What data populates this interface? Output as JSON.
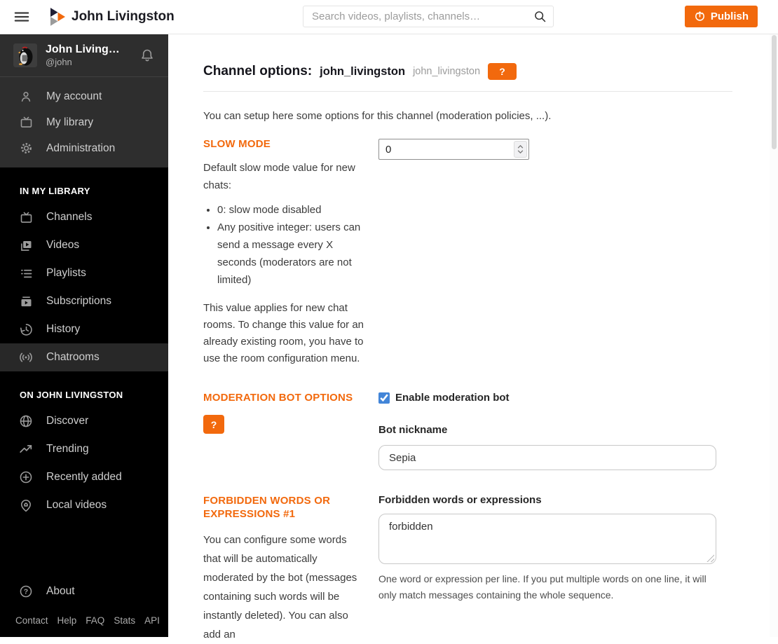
{
  "header": {
    "instance_name": "John Livingston",
    "search_placeholder": "Search videos, playlists, channels…",
    "publish_label": "Publish"
  },
  "sidebar": {
    "user": {
      "name": "John Livingston",
      "handle": "@john"
    },
    "account_menu": [
      {
        "label": "My account",
        "icon": "user-icon"
      },
      {
        "label": "My library",
        "icon": "tv-icon"
      },
      {
        "label": "Administration",
        "icon": "gear-icon"
      }
    ],
    "sections": [
      {
        "title": "IN MY LIBRARY",
        "items": [
          {
            "label": "Channels",
            "icon": "tv-icon"
          },
          {
            "label": "Videos",
            "icon": "videos-icon"
          },
          {
            "label": "Playlists",
            "icon": "playlist-icon"
          },
          {
            "label": "Subscriptions",
            "icon": "subscriptions-icon"
          },
          {
            "label": "History",
            "icon": "history-icon"
          },
          {
            "label": "Chatrooms",
            "icon": "broadcast-icon",
            "active": true
          }
        ]
      },
      {
        "title": "ON JOHN LIVINGSTON",
        "items": [
          {
            "label": "Discover",
            "icon": "globe-icon"
          },
          {
            "label": "Trending",
            "icon": "trending-icon"
          },
          {
            "label": "Recently added",
            "icon": "plus-circle-icon"
          },
          {
            "label": "Local videos",
            "icon": "home-pin-icon"
          }
        ]
      }
    ],
    "about_label": "About",
    "footer_links": [
      "Contact",
      "Help",
      "FAQ",
      "Stats",
      "API"
    ]
  },
  "main": {
    "title": "Channel options:",
    "title_channel": "john_livingston",
    "title_handle": "john_livingston",
    "help_button": "?",
    "intro": "You can setup here some options for this channel (moderation policies, ...).",
    "slow_mode": {
      "label": "SLOW MODE",
      "description": "Default slow mode value for new chats:",
      "bullets": [
        "0: slow mode disabled",
        "Any positive integer: users can send a message every X seconds (moderators are not limited)"
      ],
      "note": "This value applies for new chat rooms. To change this value for an already existing room, you have to use the room configuration menu.",
      "value": "0"
    },
    "moderation_bot": {
      "label": "MODERATION BOT OPTIONS",
      "help_button": "?",
      "enable_label": "Enable moderation bot",
      "enabled": true,
      "nickname_label": "Bot nickname",
      "nickname_value": "Sepia"
    },
    "forbidden_words": {
      "label": "FORBIDDEN WORDS OR EXPRESSIONS #1",
      "description": "You can configure some words that will be automatically moderated by the bot (messages containing such words will be instantly deleted). You can also add an",
      "field_label": "Forbidden words or expressions",
      "field_value": "forbidden",
      "field_help": "One word or expression per line. If you put multiple words on one line, it will only match messages containing the whole sequence."
    }
  },
  "colors": {
    "accent_orange": "#f2690d",
    "checkbox_blue": "#4285d8",
    "sidebar_black": "#000000",
    "sidebar_gray": "#2e2e2e"
  }
}
